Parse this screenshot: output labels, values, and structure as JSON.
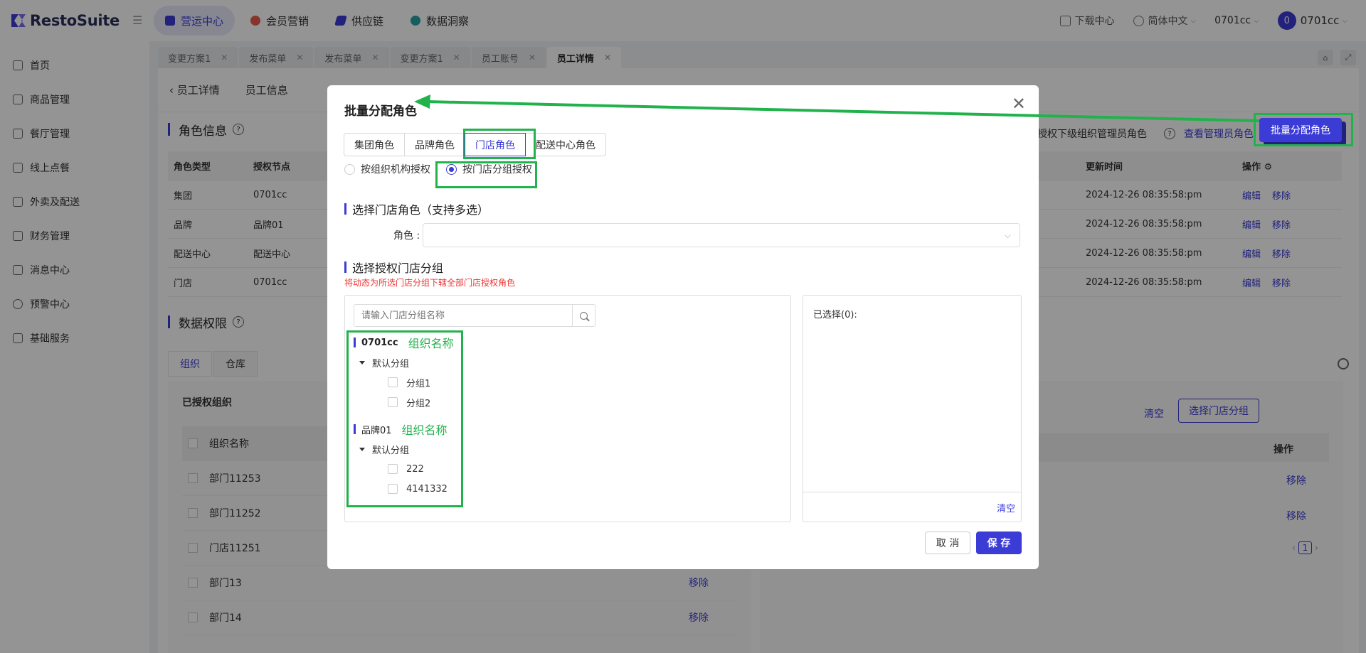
{
  "app": {
    "name": "RestoSuite"
  },
  "topnav": [
    {
      "label": "营运中心",
      "color": "#3b3bd6"
    },
    {
      "label": "会员营销",
      "color": "#e85a4f"
    },
    {
      "label": "供应链",
      "color": "#3b3bd6"
    },
    {
      "label": "数据洞察",
      "color": "#2aa3a3"
    }
  ],
  "top_right": {
    "download": "下载中心",
    "language": "简体中文",
    "org": "0701cc",
    "avatar_letter": "0",
    "user": "0701cc"
  },
  "sidebar": {
    "items": [
      {
        "label": "首页",
        "icon": "home-icon"
      },
      {
        "label": "商品管理",
        "icon": "cube-icon"
      },
      {
        "label": "餐厅管理",
        "icon": "store-icon"
      },
      {
        "label": "线上点餐",
        "icon": "hand-icon"
      },
      {
        "label": "外卖及配送",
        "icon": "bag-icon"
      },
      {
        "label": "财务管理",
        "icon": "folder-icon"
      },
      {
        "label": "消息中心",
        "icon": "mail-icon"
      },
      {
        "label": "预警中心",
        "icon": "bulb-icon"
      },
      {
        "label": "基础服务",
        "icon": "grid-icon"
      }
    ]
  },
  "tabs": [
    {
      "label": "变更方案1"
    },
    {
      "label": "发布菜单"
    },
    {
      "label": "发布菜单"
    },
    {
      "label": "变更方案1"
    },
    {
      "label": "员工账号"
    },
    {
      "label": "员工详情",
      "active": true
    }
  ],
  "page": {
    "back_label": "员工详情",
    "subtabs": [
      "员工信息"
    ],
    "role_section": "角色信息",
    "right_text": "授权下级组织管理员角色",
    "view_admin_link": "查看管理员角色",
    "batch_button": "批量分配角色",
    "table": {
      "headers": [
        "角色类型",
        "授权节点",
        "更新时间",
        "操作"
      ],
      "rows": [
        {
          "type": "集团",
          "node": "0701cc",
          "time": "2024-12-26 08:35:58:pm"
        },
        {
          "type": "品牌",
          "node": "品牌01",
          "time": "2024-12-26 08:35:58:pm"
        },
        {
          "type": "配送中心",
          "node": "配送中心",
          "time": "2024-12-26 08:35:58:pm"
        },
        {
          "type": "门店",
          "node": "0701cc",
          "time": "2024-12-26 08:35:58:pm"
        }
      ],
      "edit": "编辑",
      "remove": "移除"
    },
    "data_section": "数据权限",
    "lower_tabs": [
      "组织",
      "仓库"
    ],
    "authorized_org": "已授权组织",
    "org_col": "组织名称",
    "op_col": "操作",
    "org_rows": [
      "部门11253",
      "部门11252",
      "门店11251",
      "部门13",
      "部门14"
    ],
    "clear": "清空",
    "select_store_group": "选择门店分组",
    "page_num": "1"
  },
  "modal": {
    "title": "批量分配角色",
    "role_tabs": [
      "集团角色",
      "品牌角色",
      "门店角色",
      "配送中心角色"
    ],
    "radios": [
      "按组织机构授权",
      "按门店分组授权"
    ],
    "section_role": "选择门店角色（支持多选）",
    "role_label": "角色 :",
    "section_group": "选择授权门店分组",
    "hint": "将动态为所选门店分组下辖全部门店授权角色",
    "search_placeholder": "请输入门店分组名称",
    "tree": [
      {
        "org": "0701cc",
        "note": "组织名称",
        "group": "默认分组",
        "leaves": [
          "分组1",
          "分组2"
        ]
      },
      {
        "org": "品牌01",
        "note": "组织名称",
        "group": "默认分组",
        "leaves": [
          "222",
          "4141332"
        ]
      }
    ],
    "selected": "已选择(0):",
    "clear": "清空",
    "cancel": "取 消",
    "save": "保 存"
  },
  "annotation_color": "#22b24c"
}
